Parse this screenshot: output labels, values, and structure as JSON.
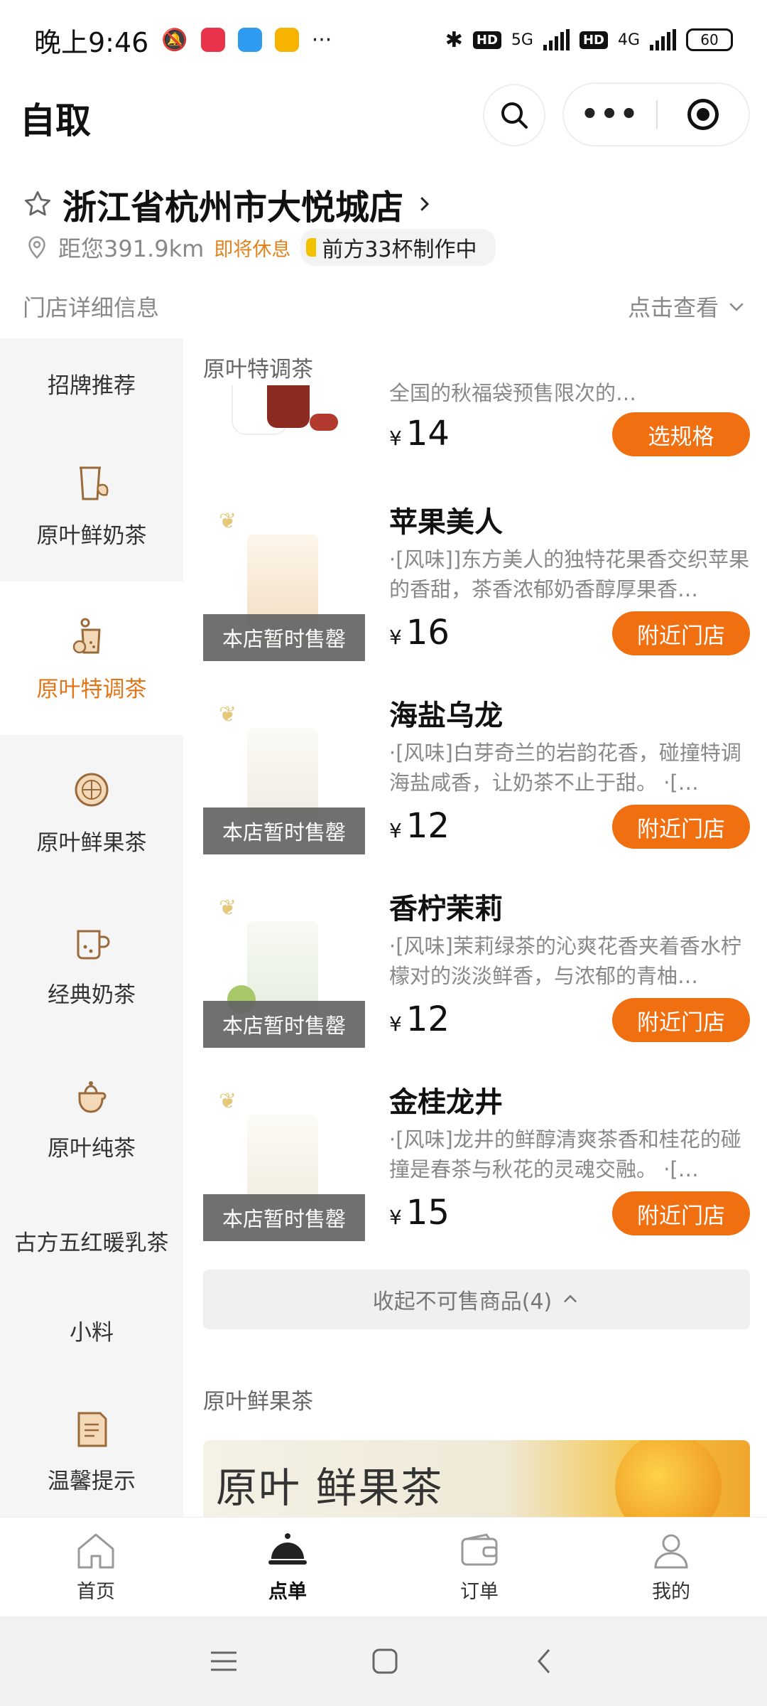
{
  "status": {
    "time": "晚上9:46",
    "net1": "5G",
    "net2": "4G",
    "battery": "60"
  },
  "header": {
    "title": "自取"
  },
  "store": {
    "name": "浙江省杭州市大悦城店",
    "distance": "距您391.9km",
    "closing": "即将休息",
    "queue": "前方33杯制作中",
    "detail_label": "门店详细信息",
    "detail_link": "点击查看"
  },
  "sidebar": {
    "items": [
      {
        "label": "招牌推荐"
      },
      {
        "label": "原叶鲜奶茶"
      },
      {
        "label": "原叶特调茶"
      },
      {
        "label": "原叶鲜果茶"
      },
      {
        "label": "经典奶茶"
      },
      {
        "label": "原叶纯茶"
      },
      {
        "label": "古方五红暖乳茶"
      },
      {
        "label": "小料"
      },
      {
        "label": "温馨提示"
      }
    ]
  },
  "main": {
    "section1": "原叶特调茶",
    "partial_desc": "全国的秋福袋预售限次的…",
    "partial_price": "14",
    "partial_btn": "选规格",
    "products": [
      {
        "name": "苹果美人",
        "desc": "·[风味]]东方美人的独特花果香交织苹果的香甜，茶香浓郁奶香醇厚果香…",
        "price": "16",
        "btn": "附近门店",
        "status": "本店暂时售罄"
      },
      {
        "name": "海盐乌龙",
        "desc": "·[风味]白芽奇兰的岩韵花香，碰撞特调海盐咸香，让奶茶不止于甜。 ·[…",
        "price": "12",
        "btn": "附近门店",
        "status": "本店暂时售罄"
      },
      {
        "name": "香柠茉莉",
        "desc": "·[风味]茉莉绿茶的沁爽花香夹着香水柠檬对的淡淡鲜香，与浓郁的青柚…",
        "price": "12",
        "btn": "附近门店",
        "status": "本店暂时售罄"
      },
      {
        "name": "金桂龙井",
        "desc": "·[风味]龙井的鲜醇清爽茶香和桂花的碰撞是春茶与秋花的灵魂交融。 ·[…",
        "price": "15",
        "btn": "附近门店",
        "status": "本店暂时售罄"
      }
    ],
    "yen": "¥",
    "collapse": "收起不可售商品(4)",
    "section2": "原叶鲜果茶",
    "banner": "原叶 鲜果茶"
  },
  "tabbar": {
    "items": [
      {
        "label": "首页"
      },
      {
        "label": "点单"
      },
      {
        "label": "订单"
      },
      {
        "label": "我的"
      }
    ]
  },
  "colors": {
    "accent": "#ef6f11",
    "active_text": "#e0761a"
  }
}
